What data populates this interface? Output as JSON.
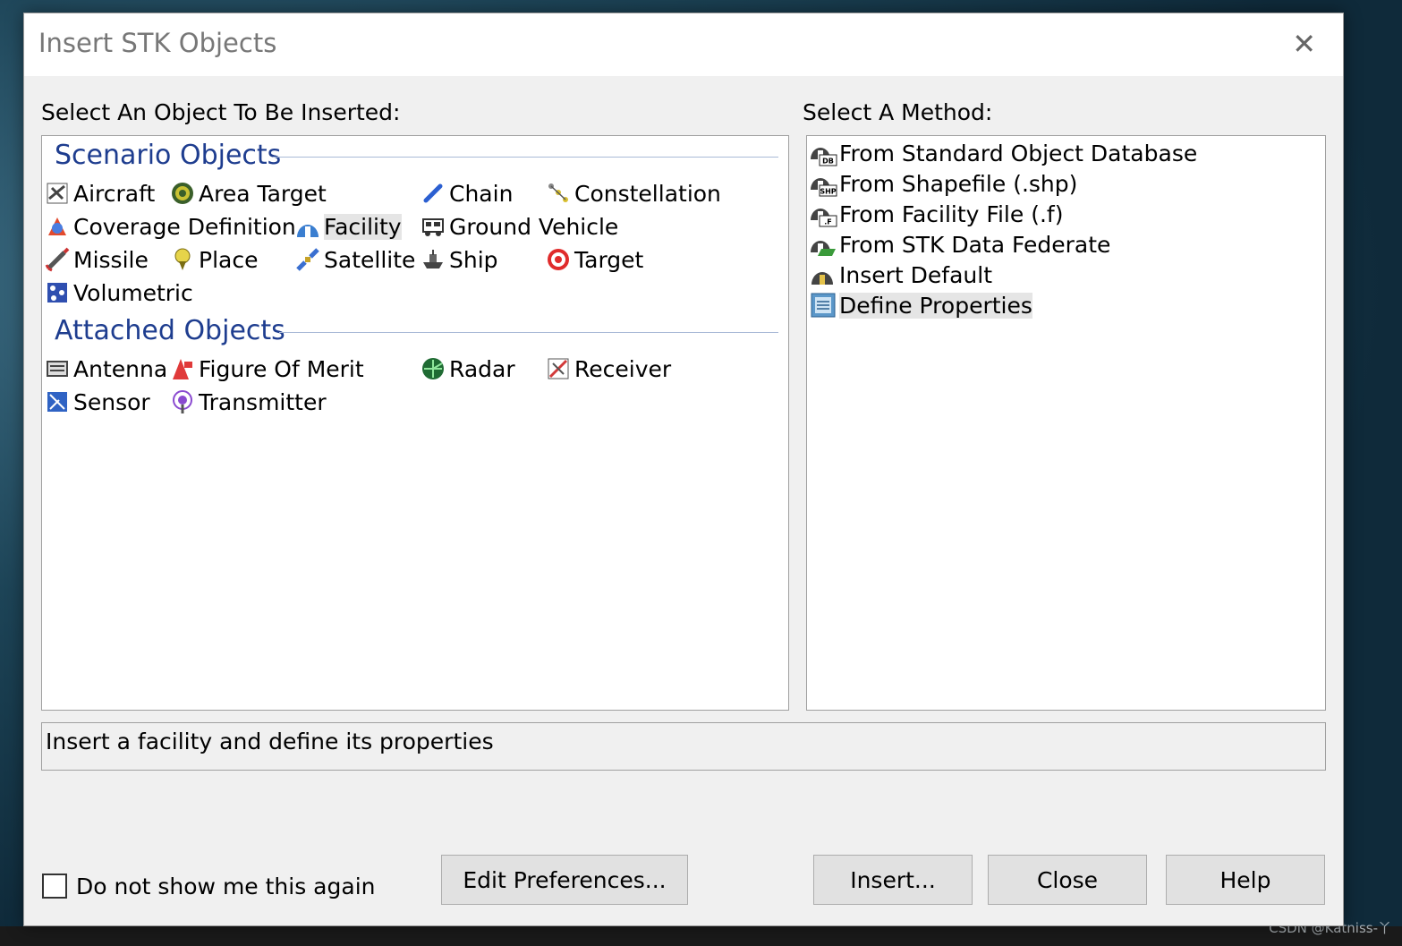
{
  "window": {
    "title": "Insert STK Objects",
    "close_glyph": "✕"
  },
  "left_label": "Select An Object To Be Inserted:",
  "right_label": "Select A Method:",
  "scenario_objects": {
    "header": "Scenario Objects",
    "items": [
      {
        "label": "Aircraft",
        "icon": "aircraft-icon"
      },
      {
        "label": "Area Target",
        "icon": "area-target-icon"
      },
      {
        "label": "Chain",
        "icon": "chain-icon"
      },
      {
        "label": "Constellation",
        "icon": "constellation-icon"
      },
      {
        "label": "Coverage Definition",
        "icon": "coverage-definition-icon"
      },
      {
        "label": "Facility",
        "icon": "facility-icon",
        "selected": true
      },
      {
        "label": "Ground Vehicle",
        "icon": "ground-vehicle-icon"
      },
      {
        "label": "Missile",
        "icon": "missile-icon"
      },
      {
        "label": "Place",
        "icon": "place-icon"
      },
      {
        "label": "Satellite",
        "icon": "satellite-icon"
      },
      {
        "label": "Ship",
        "icon": "ship-icon"
      },
      {
        "label": "Target",
        "icon": "target-icon"
      },
      {
        "label": "Volumetric",
        "icon": "volumetric-icon"
      }
    ]
  },
  "attached_objects": {
    "header": "Attached Objects",
    "items": [
      {
        "label": "Antenna",
        "icon": "antenna-icon"
      },
      {
        "label": "Figure Of Merit",
        "icon": "figure-of-merit-icon"
      },
      {
        "label": "Radar",
        "icon": "radar-icon"
      },
      {
        "label": "Receiver",
        "icon": "receiver-icon"
      },
      {
        "label": "Sensor",
        "icon": "sensor-icon"
      },
      {
        "label": "Transmitter",
        "icon": "transmitter-icon"
      }
    ]
  },
  "methods": [
    {
      "label": "From Standard Object Database",
      "icon": "database-icon",
      "badge": "DB"
    },
    {
      "label": "From Shapefile (.shp)",
      "icon": "shapefile-icon",
      "badge": "SHP"
    },
    {
      "label": "From Facility File (.f)",
      "icon": "facility-file-icon",
      "badge": ".F"
    },
    {
      "label": "From STK Data Federate",
      "icon": "data-federate-icon",
      "badge": ""
    },
    {
      "label": "Insert Default",
      "icon": "insert-default-icon",
      "badge": ""
    },
    {
      "label": "Define Properties",
      "icon": "define-properties-icon",
      "badge": "",
      "selected": true
    }
  ],
  "description": "Insert a facility and define its properties",
  "checkbox_label": "Do not show me this again",
  "buttons": {
    "edit_preferences": "Edit Preferences...",
    "insert": "Insert...",
    "close": "Close",
    "help": "Help"
  },
  "watermark": "CSDN @Katniss-丫",
  "colors": {
    "group_header": "#1e3d8f",
    "selection": "#e5e5e5",
    "dialog_bg": "#f0f0f0"
  }
}
